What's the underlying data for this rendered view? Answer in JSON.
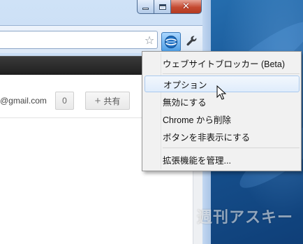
{
  "window": {
    "controls": {
      "minimize": "minimize",
      "maximize": "maximize",
      "close": "close"
    }
  },
  "toolbar": {
    "bookmark_icon": "star-icon",
    "extension_icon": "website-blocker-icon",
    "menu_icon": "wrench-icon"
  },
  "content": {
    "email_fragment": "@gmail.com",
    "count_label": "0",
    "share_label": "共有"
  },
  "context_menu": {
    "items": [
      {
        "label": "ウェブサイトブロッカー (Beta)",
        "state": "normal"
      },
      {
        "label": "オプション",
        "state": "hover"
      },
      {
        "label": "無効にする",
        "state": "normal"
      },
      {
        "label": "Chrome から削除",
        "state": "normal"
      },
      {
        "label": "ボタンを非表示にする",
        "state": "normal"
      },
      {
        "label": "拡張機能を管理...",
        "state": "normal"
      }
    ]
  },
  "watermark": "週刊アスキー",
  "colors": {
    "close_button": "#c44a31",
    "menu_hover_border": "#a9c9ee",
    "desktop": "#1a5a9a"
  }
}
